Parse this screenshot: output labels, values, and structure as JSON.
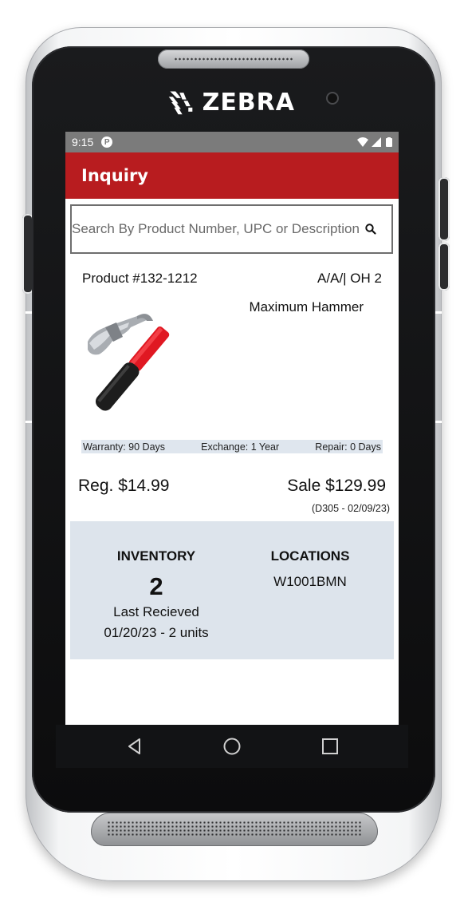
{
  "device": {
    "brand": "ZEBRA"
  },
  "status_bar": {
    "time": "9:15",
    "app_icon": "P",
    "icons": [
      "wifi-icon",
      "signal-icon",
      "battery-icon"
    ]
  },
  "app_bar": {
    "title": "Inquiry",
    "color": "#b81c1f"
  },
  "search": {
    "placeholder": "Search By Product Number, UPC or Description",
    "value": ""
  },
  "product": {
    "number": "Product #132-1212",
    "code": "A/A/| OH 2",
    "name": "Maximum Hammer",
    "image": "hammer-image",
    "warranty": "Warranty: 90 Days",
    "exchange": "Exchange: 1 Year",
    "repair": "Repair: 0 Days",
    "reg_price": "Reg. $14.99",
    "sale_price": "Sale $129.99",
    "sale_note": "(D305 - 02/09/23)"
  },
  "inventory": {
    "heading": "INVENTORY",
    "count": "2",
    "last_received_label": "Last Recieved",
    "last_received_value": "01/20/23 - 2 units"
  },
  "locations": {
    "heading": "LOCATIONS",
    "items": [
      "W1001BMN"
    ]
  },
  "nav": {
    "buttons": [
      "back-icon",
      "home-icon",
      "recents-icon"
    ]
  }
}
